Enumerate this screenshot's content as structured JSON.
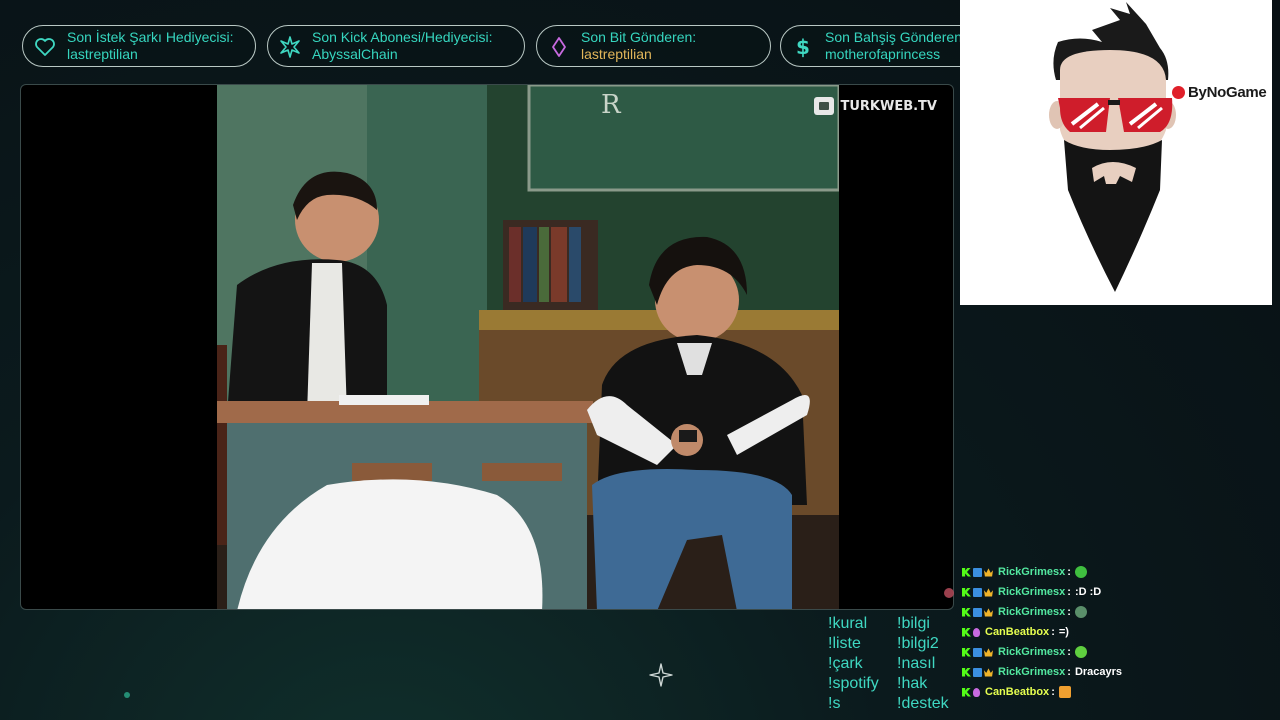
{
  "alerts": [
    {
      "label": "Son İstek Şarkı Hediyecisi:",
      "name": "lastreptilian",
      "icon": "heart-icon"
    },
    {
      "label": "Son Kick Abonesi/Hediyecisi:",
      "name": "AbyssalChain",
      "icon": "star-icon"
    },
    {
      "label": "Son Bit Gönderen:",
      "name": "lastreptilian",
      "icon": "diamond-icon"
    },
    {
      "label": "Son Bahşiş Gönderen",
      "name": "motherofaprincess",
      "icon": "dollar-icon"
    }
  ],
  "video": {
    "watermark": "TURKWEB.TV",
    "board_letter": "R"
  },
  "webcam": {
    "brand": "ByNoGame"
  },
  "chat": [
    {
      "user": "RickGrimesx",
      "colon": ":",
      "message": "",
      "emote": "green-emote",
      "emote_color": "#3fbf3f"
    },
    {
      "user": "RickGrimesx",
      "colon": ":",
      "message": ":D :D",
      "emote": "",
      "emote_color": ""
    },
    {
      "user": "RickGrimesx",
      "colon": ":",
      "message": "",
      "emote": "face-emote",
      "emote_color": "#5a8f6a"
    },
    {
      "user": "CanBeatbox",
      "colon": ":",
      "message": "=)",
      "emote": "",
      "emote_color": ""
    },
    {
      "user": "RickGrimesx",
      "colon": ":",
      "message": "",
      "emote": "frog-emote",
      "emote_color": "#5fcf3f"
    },
    {
      "user": "RickGrimesx",
      "colon": ":",
      "message": "Dracayrs",
      "emote": "",
      "emote_color": ""
    },
    {
      "user": "CanBeatbox",
      "colon": ":",
      "message": "",
      "emote": "fire-emote",
      "emote_color": "#f0a030"
    }
  ],
  "commands": {
    "left": [
      "!kural",
      "!liste",
      "!çark",
      "!spotify",
      "!s"
    ],
    "right": [
      "!bilgi",
      "!bilgi2",
      "!nasıl",
      "!hak",
      "!destek"
    ]
  },
  "colors": {
    "accent": "#3fd8c2",
    "bits": "#e2b65a",
    "kick_green": "#53fc18",
    "brand_red": "#e0202a"
  }
}
